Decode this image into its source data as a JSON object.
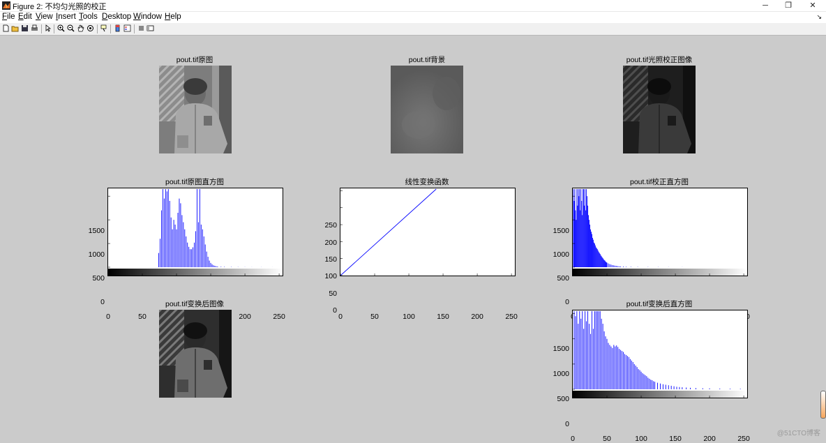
{
  "window": {
    "title": "Figure 2: 不均匀光照的校正",
    "minimize": "─",
    "maximize": "❐",
    "close": "✕"
  },
  "menu": [
    "File",
    "Edit",
    "View",
    "Insert",
    "Tools",
    "Desktop",
    "Window",
    "Help"
  ],
  "menu_mnemonic": [
    "F",
    "E",
    "V",
    "I",
    "T",
    "D",
    "W",
    "H"
  ],
  "menu_arrow": "↘",
  "toolbar_icons": [
    "new-figure-icon",
    "open-file-icon",
    "save-icon",
    "print-icon",
    "edit-plot-arrow-icon",
    "zoom-in-icon",
    "zoom-out-icon",
    "pan-hand-icon",
    "rotate-3d-icon",
    "data-cursor-icon",
    "insert-colorbar-icon",
    "insert-legend-icon",
    "hide-plot-tools-icon",
    "show-plot-tools-icon"
  ],
  "panels": {
    "orig_title": "pout.tif原图",
    "bg_title": "pout.tif背景",
    "corr_title": "pout.tif光照校正图像",
    "orig_hist_title": "pout.tif原图直方图",
    "linear_title": "线性变换函数",
    "corr_hist_title": "pout.tif校正直方图",
    "trans_title": "pout.tif变换后图像",
    "trans_hist_title": "pout.tif变换后直方图"
  },
  "watermark": "@51CTO博客",
  "chart_data": [
    {
      "type": "bar",
      "title": "pout.tif原图直方图",
      "xlim": [
        0,
        255
      ],
      "ylim": [
        0,
        1650
      ],
      "xticks": [
        0,
        50,
        100,
        150,
        200,
        250
      ],
      "yticks": [
        0,
        500,
        1000,
        1500
      ],
      "colorbar": "gray",
      "bins": [
        [
          74,
          300
        ],
        [
          76,
          600
        ],
        [
          78,
          1200
        ],
        [
          80,
          1650
        ],
        [
          82,
          1450
        ],
        [
          84,
          1650
        ],
        [
          86,
          1600
        ],
        [
          88,
          1650
        ],
        [
          90,
          1400
        ],
        [
          92,
          1050
        ],
        [
          94,
          800
        ],
        [
          96,
          1000
        ],
        [
          98,
          900
        ],
        [
          100,
          800
        ],
        [
          102,
          1150
        ],
        [
          104,
          1450
        ],
        [
          106,
          1350
        ],
        [
          108,
          1100
        ],
        [
          110,
          950
        ],
        [
          112,
          800
        ],
        [
          114,
          650
        ],
        [
          116,
          520
        ],
        [
          118,
          430
        ],
        [
          120,
          380
        ],
        [
          122,
          380
        ],
        [
          124,
          420
        ],
        [
          126,
          520
        ],
        [
          128,
          760
        ],
        [
          130,
          1650
        ],
        [
          132,
          950
        ],
        [
          134,
          1650
        ],
        [
          136,
          900
        ],
        [
          138,
          800
        ],
        [
          140,
          650
        ],
        [
          142,
          480
        ],
        [
          144,
          330
        ],
        [
          146,
          220
        ],
        [
          148,
          140
        ],
        [
          150,
          90
        ],
        [
          152,
          60
        ],
        [
          154,
          40
        ],
        [
          156,
          30
        ],
        [
          158,
          20
        ],
        [
          160,
          15
        ],
        [
          165,
          10
        ],
        [
          170,
          8
        ],
        [
          180,
          5
        ],
        [
          190,
          4
        ],
        [
          200,
          3
        ],
        [
          210,
          2
        ],
        [
          224,
          2
        ],
        [
          240,
          1
        ]
      ]
    },
    {
      "type": "line",
      "title": "线性变换函数",
      "xlim": [
        0,
        255
      ],
      "ylim": [
        0,
        255
      ],
      "xticks": [
        0,
        50,
        100,
        150,
        200,
        250
      ],
      "yticks": [
        0,
        50,
        100,
        150,
        200,
        250
      ],
      "x": [
        0,
        140
      ],
      "y": [
        0,
        255
      ]
    },
    {
      "type": "bar",
      "title": "pout.tif校正直方图",
      "xlim": [
        0,
        255
      ],
      "ylim": [
        0,
        1650
      ],
      "xticks": [
        0,
        50,
        100,
        150,
        200,
        250
      ],
      "yticks": [
        0,
        500,
        1000,
        1500
      ],
      "colorbar": "gray",
      "bins": [
        [
          1,
          1650
        ],
        [
          2,
          1400
        ],
        [
          3,
          1650
        ],
        [
          4,
          1200
        ],
        [
          5,
          1000
        ],
        [
          6,
          1650
        ],
        [
          7,
          1300
        ],
        [
          8,
          1650
        ],
        [
          9,
          1500
        ],
        [
          10,
          1650
        ],
        [
          11,
          1200
        ],
        [
          12,
          1650
        ],
        [
          13,
          1400
        ],
        [
          14,
          1100
        ],
        [
          15,
          1650
        ],
        [
          16,
          1650
        ],
        [
          17,
          1300
        ],
        [
          18,
          1650
        ],
        [
          19,
          1200
        ],
        [
          20,
          1650
        ],
        [
          21,
          1500
        ],
        [
          22,
          1300
        ],
        [
          23,
          1100
        ],
        [
          24,
          1000
        ],
        [
          25,
          900
        ],
        [
          26,
          800
        ],
        [
          27,
          750
        ],
        [
          28,
          700
        ],
        [
          29,
          620
        ],
        [
          30,
          580
        ],
        [
          31,
          520
        ],
        [
          32,
          500
        ],
        [
          33,
          460
        ],
        [
          34,
          420
        ],
        [
          35,
          400
        ],
        [
          36,
          380
        ],
        [
          37,
          350
        ],
        [
          38,
          320
        ],
        [
          39,
          300
        ],
        [
          40,
          280
        ],
        [
          41,
          250
        ],
        [
          42,
          230
        ],
        [
          43,
          210
        ],
        [
          44,
          190
        ],
        [
          45,
          170
        ],
        [
          46,
          150
        ],
        [
          47,
          140
        ],
        [
          48,
          120
        ],
        [
          49,
          105
        ],
        [
          50,
          95
        ],
        [
          52,
          80
        ],
        [
          54,
          65
        ],
        [
          56,
          55
        ],
        [
          58,
          45
        ],
        [
          60,
          40
        ],
        [
          62,
          32
        ],
        [
          64,
          28
        ],
        [
          66,
          22
        ],
        [
          68,
          18
        ],
        [
          70,
          15
        ],
        [
          74,
          12
        ],
        [
          78,
          10
        ],
        [
          85,
          8
        ],
        [
          95,
          6
        ],
        [
          110,
          5
        ],
        [
          125,
          4
        ],
        [
          140,
          3
        ],
        [
          160,
          2
        ]
      ]
    },
    {
      "type": "bar",
      "title": "pout.tif变换后直方图",
      "xlim": [
        0,
        255
      ],
      "ylim": [
        0,
        1550
      ],
      "xticks": [
        0,
        50,
        100,
        150,
        200,
        250
      ],
      "yticks": [
        0,
        500,
        1000,
        1500
      ],
      "colorbar": "gray",
      "bins": [
        [
          2,
          1550
        ],
        [
          4,
          1450
        ],
        [
          6,
          1550
        ],
        [
          8,
          1300
        ],
        [
          10,
          1550
        ],
        [
          12,
          1400
        ],
        [
          14,
          1550
        ],
        [
          16,
          1200
        ],
        [
          18,
          1550
        ],
        [
          20,
          1350
        ],
        [
          22,
          1550
        ],
        [
          24,
          1300
        ],
        [
          26,
          1100
        ],
        [
          28,
          1550
        ],
        [
          30,
          1200
        ],
        [
          32,
          1550
        ],
        [
          34,
          1550
        ],
        [
          36,
          1550
        ],
        [
          38,
          1550
        ],
        [
          40,
          1550
        ],
        [
          42,
          1400
        ],
        [
          44,
          1300
        ],
        [
          46,
          1150
        ],
        [
          48,
          1050
        ],
        [
          50,
          1000
        ],
        [
          52,
          920
        ],
        [
          54,
          880
        ],
        [
          56,
          850
        ],
        [
          58,
          820
        ],
        [
          60,
          880
        ],
        [
          62,
          850
        ],
        [
          64,
          870
        ],
        [
          66,
          840
        ],
        [
          68,
          800
        ],
        [
          70,
          780
        ],
        [
          72,
          760
        ],
        [
          74,
          740
        ],
        [
          76,
          700
        ],
        [
          78,
          680
        ],
        [
          80,
          660
        ],
        [
          82,
          640
        ],
        [
          84,
          600
        ],
        [
          86,
          570
        ],
        [
          88,
          540
        ],
        [
          90,
          500
        ],
        [
          92,
          470
        ],
        [
          94,
          440
        ],
        [
          96,
          400
        ],
        [
          98,
          380
        ],
        [
          100,
          350
        ],
        [
          102,
          320
        ],
        [
          104,
          300
        ],
        [
          106,
          280
        ],
        [
          108,
          260
        ],
        [
          110,
          230
        ],
        [
          112,
          210
        ],
        [
          114,
          190
        ],
        [
          116,
          180
        ],
        [
          118,
          160
        ],
        [
          120,
          150
        ],
        [
          124,
          130
        ],
        [
          128,
          115
        ],
        [
          132,
          100
        ],
        [
          136,
          90
        ],
        [
          140,
          80
        ],
        [
          144,
          70
        ],
        [
          148,
          60
        ],
        [
          152,
          50
        ],
        [
          156,
          45
        ],
        [
          160,
          40
        ],
        [
          166,
          35
        ],
        [
          172,
          30
        ],
        [
          180,
          25
        ],
        [
          190,
          20
        ],
        [
          200,
          18
        ],
        [
          215,
          15
        ],
        [
          230,
          12
        ],
        [
          245,
          10
        ]
      ]
    }
  ]
}
